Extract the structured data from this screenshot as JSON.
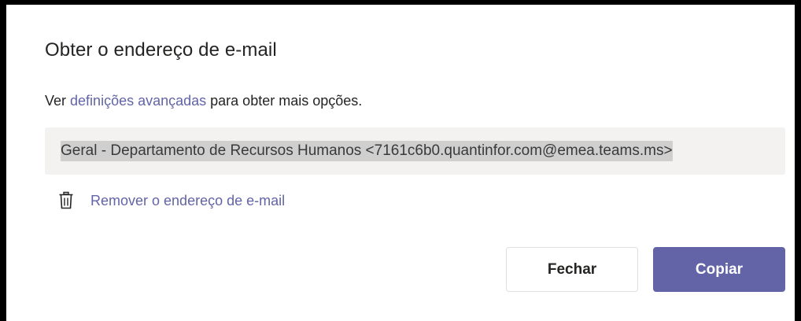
{
  "dialog": {
    "title": "Obter o endereço de e-mail",
    "subtitle_prefix": "Ver ",
    "subtitle_link": "definições avançadas",
    "subtitle_suffix": " para obter mais opções.",
    "email_value": "Geral - Departamento de Recursos Humanos <7161c6b0.quantinfor.com@emea.teams.ms>",
    "remove_label": "Remover o endereço de e-mail",
    "close_label": "Fechar",
    "copy_label": "Copiar"
  },
  "colors": {
    "accent": "#6264a7",
    "text": "#252423",
    "field_bg": "#f3f2f1",
    "selection": "#cfcfcf"
  },
  "icons": {
    "remove": "trash-icon"
  }
}
